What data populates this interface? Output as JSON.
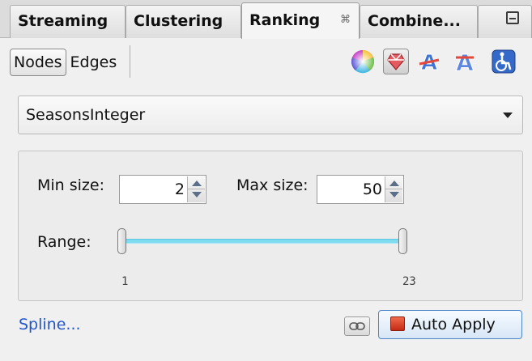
{
  "tabs": [
    {
      "label": "Streaming",
      "active": false
    },
    {
      "label": "Clustering",
      "active": false
    },
    {
      "label": "Ranking",
      "active": true,
      "close_glyph": "⌘"
    },
    {
      "label": "Combine...",
      "active": false
    }
  ],
  "toolbar": {
    "nodes_label": "Nodes",
    "edges_label": "Edges",
    "icons": [
      "color-wheel-icon",
      "size-icon",
      "label-color-icon",
      "label-size-icon",
      "transformer-icon"
    ],
    "selected_mode": "Nodes",
    "selected_transformer": "size-icon"
  },
  "attribute_select": {
    "value": "SeasonsInteger"
  },
  "size_panel": {
    "min_label": "Min size:",
    "min_value": "2",
    "max_label": "Max size:",
    "max_value": "50",
    "range_label": "Range:",
    "range_min": "1",
    "range_max": "23",
    "range_low_fraction": 0.0,
    "range_high_fraction": 1.0,
    "track_color": "#7fdcf0"
  },
  "footer": {
    "spline_label": "Spline...",
    "auto_apply_label": "Auto Apply",
    "accent_color": "#4f86c9"
  }
}
